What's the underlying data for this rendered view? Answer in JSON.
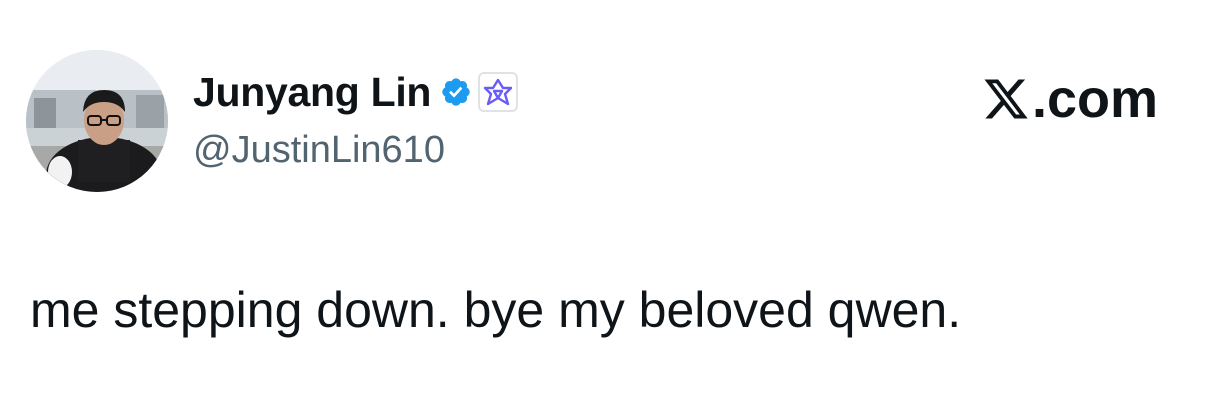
{
  "author": {
    "display_name": "Junyang Lin",
    "handle": "@JustinLin610",
    "verified": true,
    "verified_badge_icon": "verified-check-icon",
    "affiliate_badge_icon": "qwen-logo-icon"
  },
  "brand": {
    "label": ".com",
    "icon": "x-logo-icon"
  },
  "tweet": {
    "text": "me stepping down. bye my beloved qwen."
  },
  "colors": {
    "verified_blue": "#1d9bf0",
    "affiliate_purple": "#6a5cf6",
    "handle_gray": "#536471",
    "text_black": "#0f1419"
  }
}
